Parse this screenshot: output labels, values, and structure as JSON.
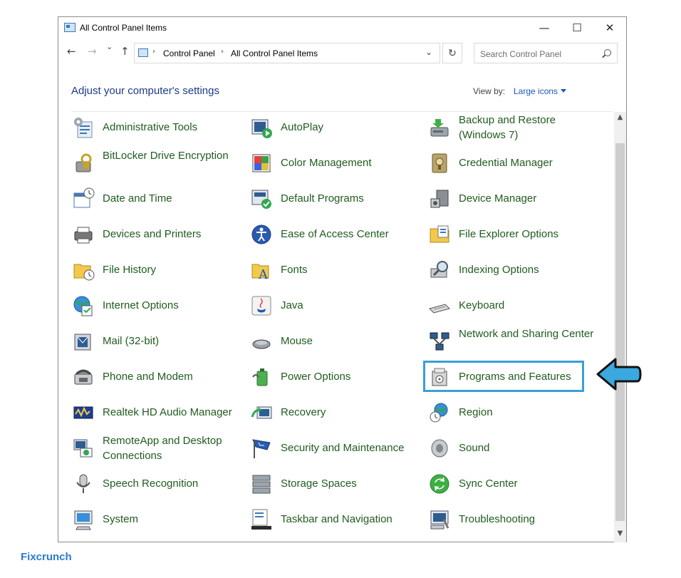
{
  "window": {
    "title": "All Control Panel Items",
    "minimize_glyph": "—",
    "maximize_glyph": "☐",
    "close_glyph": "✕"
  },
  "nav": {
    "back_glyph": "←",
    "forward_glyph": "→",
    "recent_glyph": "⌄",
    "up_glyph": "↑",
    "breadcrumb": [
      "Control Panel",
      "All Control Panel Items"
    ],
    "breadcrumb_sep": "›",
    "dropdown_glyph": "⌄",
    "refresh_glyph": "↻",
    "search_placeholder": "Search Control Panel"
  },
  "header": {
    "heading": "Adjust your computer's settings",
    "view_by_label": "View by:",
    "view_by_value": "Large icons"
  },
  "items": [
    {
      "label": "Administrative Tools",
      "icon": "admin-tools-icon"
    },
    {
      "label": "AutoPlay",
      "icon": "autoplay-icon"
    },
    {
      "label": "Backup and Restore (Windows 7)",
      "icon": "backup-restore-icon"
    },
    {
      "label": "BitLocker Drive Encryption",
      "icon": "bitlocker-icon"
    },
    {
      "label": "Color Management",
      "icon": "color-management-icon"
    },
    {
      "label": "Credential Manager",
      "icon": "credential-manager-icon"
    },
    {
      "label": "Date and Time",
      "icon": "date-time-icon"
    },
    {
      "label": "Default Programs",
      "icon": "default-programs-icon"
    },
    {
      "label": "Device Manager",
      "icon": "device-manager-icon"
    },
    {
      "label": "Devices and Printers",
      "icon": "devices-printers-icon"
    },
    {
      "label": "Ease of Access Center",
      "icon": "ease-of-access-icon"
    },
    {
      "label": "File Explorer Options",
      "icon": "file-explorer-options-icon"
    },
    {
      "label": "File History",
      "icon": "file-history-icon"
    },
    {
      "label": "Fonts",
      "icon": "fonts-icon"
    },
    {
      "label": "Indexing Options",
      "icon": "indexing-options-icon"
    },
    {
      "label": "Internet Options",
      "icon": "internet-options-icon"
    },
    {
      "label": "Java",
      "icon": "java-icon"
    },
    {
      "label": "Keyboard",
      "icon": "keyboard-icon"
    },
    {
      "label": "Mail (32-bit)",
      "icon": "mail-icon"
    },
    {
      "label": "Mouse",
      "icon": "mouse-icon"
    },
    {
      "label": "Network and Sharing Center",
      "icon": "network-sharing-icon"
    },
    {
      "label": "Phone and Modem",
      "icon": "phone-modem-icon"
    },
    {
      "label": "Power Options",
      "icon": "power-options-icon"
    },
    {
      "label": "Programs and Features",
      "icon": "programs-features-icon"
    },
    {
      "label": "Realtek HD Audio Manager",
      "icon": "realtek-audio-icon"
    },
    {
      "label": "Recovery",
      "icon": "recovery-icon"
    },
    {
      "label": "Region",
      "icon": "region-icon"
    },
    {
      "label": "RemoteApp and Desktop Connections",
      "icon": "remoteapp-icon"
    },
    {
      "label": "Security and Maintenance",
      "icon": "security-maintenance-icon"
    },
    {
      "label": "Sound",
      "icon": "sound-icon"
    },
    {
      "label": "Speech Recognition",
      "icon": "speech-recognition-icon"
    },
    {
      "label": "Storage Spaces",
      "icon": "storage-spaces-icon"
    },
    {
      "label": "Sync Center",
      "icon": "sync-center-icon"
    },
    {
      "label": "System",
      "icon": "system-icon"
    },
    {
      "label": "Taskbar and Navigation",
      "icon": "taskbar-navigation-icon"
    },
    {
      "label": "Troubleshooting",
      "icon": "troubleshooting-icon"
    }
  ],
  "highlighted_item": "Programs and Features",
  "colors": {
    "item_label": "#1f5c1f",
    "heading": "#1e3a8a",
    "highlight_border": "#3a9fd6",
    "arrow_fill": "#3ba8e0"
  },
  "watermark": {
    "brand": "Fixcrunch"
  }
}
